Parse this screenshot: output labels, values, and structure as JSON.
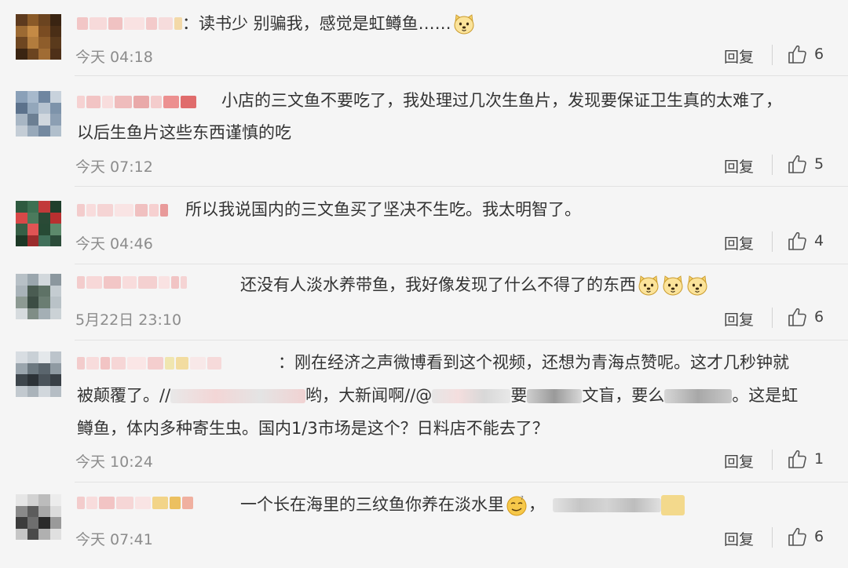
{
  "comments": [
    {
      "colon": "：",
      "text": "读书少 别骗我，感觉是虹鳟鱼……",
      "time": "今天 04:18",
      "reply": "回复",
      "likes": "6"
    },
    {
      "text": "小店的三文鱼不要吃了，我处理过几次生鱼片，发现要保证卫生真的太难了，",
      "text2": "以后生鱼片这些东西谨慎的吃",
      "time": "今天 07:12",
      "reply": "回复",
      "likes": "5"
    },
    {
      "text": "所以我说国内的三文鱼买了坚决不生吃。我太明智了。",
      "time": "今天 04:46",
      "reply": "回复",
      "likes": "4"
    },
    {
      "text": "还没有人淡水养带鱼，我好像发现了什么不得了的东西",
      "time": "5月22日 23:10",
      "reply": "回复",
      "likes": "6"
    },
    {
      "colon": "：",
      "text": "刚在经济之声微博看到这个视频，还想为青海点赞呢。这才几秒钟就",
      "text2a": "被颠覆了。//",
      "text2b": "哟，大新闻啊//@",
      "text2c": "要",
      "text2d": "文盲，要么",
      "text2e": "。这是虹",
      "text3": "鳟鱼，体内多种寄生虫。国内1/3市场是这个？日料店不能去了？",
      "time": "今天 10:24",
      "reply": "回复",
      "likes": "1"
    },
    {
      "text": "一个长在海里的三纹鱼你养在淡水里",
      "text_tail": "，",
      "time": "今天 07:41",
      "reply": "回复",
      "likes": "6"
    }
  ]
}
